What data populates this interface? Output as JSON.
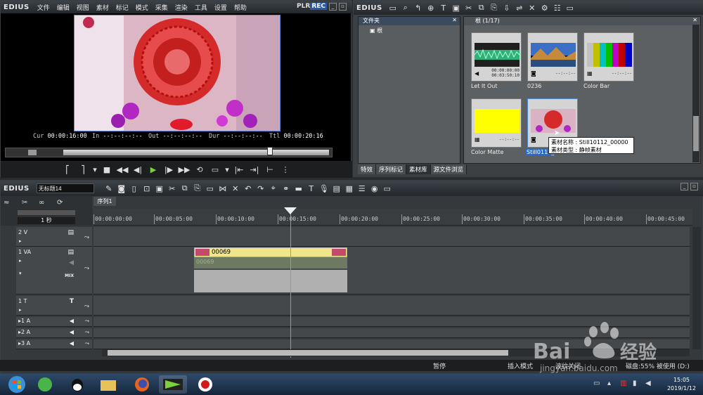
{
  "player": {
    "logo": "EDIUS",
    "menu": [
      "文件",
      "编辑",
      "视图",
      "素材",
      "标记",
      "模式",
      "采集",
      "渲染",
      "工具",
      "设置",
      "帮助"
    ],
    "plr": "PLR",
    "rec": "REC",
    "timecodes": {
      "cur_label": "Cur",
      "cur": "00:00:16:00",
      "in_label": "In",
      "in": "--:--:--:--",
      "out_label": "Out",
      "out": "--:--:--:--",
      "dur_label": "Dur",
      "dur": "--:--:--:--",
      "ttl_label": "Ttl",
      "ttl": "00:00:20:16"
    }
  },
  "bin": {
    "logo": "EDIUS",
    "folder_title": "文件夹",
    "folder_root": "根",
    "clip_header": "根 (1/17)",
    "clips": [
      {
        "label": "Let It Out",
        "tc1": "00:00:00:00",
        "tc2": "00:03:50:10"
      },
      {
        "label": "0236",
        "tc1": "--:--:--"
      },
      {
        "label": "Color Bar",
        "tc1": "--:--:--"
      },
      {
        "label": "Color Matte",
        "tc1": "--:--:--"
      },
      {
        "label": "Still0112_",
        "tc1": "--:--:--"
      }
    ],
    "tooltip_name_label": "素材名称",
    "tooltip_name": "Still10112_00000",
    "tooltip_type_label": "素材类型",
    "tooltip_type": "静帧素材",
    "tabs": [
      "特效",
      "序列标记",
      "素材库",
      "源文件浏览"
    ]
  },
  "timeline": {
    "logo": "EDIUS",
    "project_name": "无标题14",
    "sequence_tab": "序列1",
    "zoom": "1 秒",
    "ruler": [
      "00:00:00:00",
      "00:00:05:00",
      "00:00:10:00",
      "00:00:15:00",
      "00:00:20:00",
      "00:00:25:00",
      "00:00:30:00",
      "00:00:35:00",
      "00:00:40:00",
      "00:00:45:00"
    ],
    "tracks": {
      "v2": "2 V",
      "va1": "1 VA",
      "mix": "MIX",
      "t1": "1 T",
      "a1": "1 A",
      "a2": "2 A",
      "a3": "3 A"
    },
    "clip_video_name": "00069",
    "clip_audio_name": "00069"
  },
  "status": {
    "pause": "暂停",
    "insert_mode": "插入模式",
    "ripple_off": "波纹关闭",
    "disk": "磁盘:55% 被使用 (D:)"
  },
  "taskbar": {
    "time": "15:05",
    "date": "2019/1/12"
  },
  "colors": {
    "accent": "#4ab3e6",
    "clip_video": "#f2e68c",
    "rec": "#2a5aa8"
  }
}
